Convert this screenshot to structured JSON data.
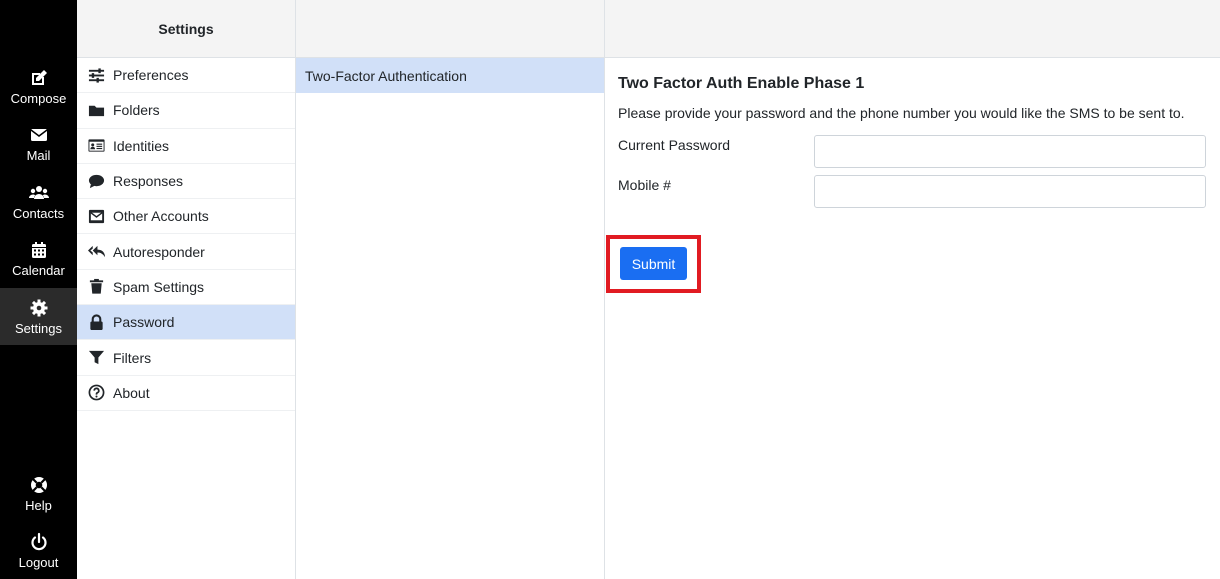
{
  "taskbar": {
    "items": [
      {
        "label": "Compose",
        "icon": "compose-icon"
      },
      {
        "label": "Mail",
        "icon": "mail-icon"
      },
      {
        "label": "Contacts",
        "icon": "contacts-icon"
      },
      {
        "label": "Calendar",
        "icon": "calendar-icon"
      },
      {
        "label": "Settings",
        "icon": "gear-icon",
        "active": true
      },
      {
        "label": "Help",
        "icon": "lifebuoy-icon"
      },
      {
        "label": "Logout",
        "icon": "power-icon"
      }
    ]
  },
  "settings": {
    "title": "Settings",
    "items": [
      {
        "label": "Preferences",
        "icon": "sliders-icon"
      },
      {
        "label": "Folders",
        "icon": "folder-icon"
      },
      {
        "label": "Identities",
        "icon": "id-card-icon"
      },
      {
        "label": "Responses",
        "icon": "comment-icon"
      },
      {
        "label": "Other Accounts",
        "icon": "envelope-square-icon"
      },
      {
        "label": "Autoresponder",
        "icon": "reply-all-icon"
      },
      {
        "label": "Spam Settings",
        "icon": "trash-icon"
      },
      {
        "label": "Password",
        "icon": "lock-icon",
        "selected": true
      },
      {
        "label": "Filters",
        "icon": "filter-icon"
      },
      {
        "label": "About",
        "icon": "question-circle-icon"
      }
    ]
  },
  "list": {
    "items": [
      {
        "label": "Two-Factor Authentication",
        "selected": true
      }
    ]
  },
  "form": {
    "title": "Two Factor Auth Enable Phase 1",
    "description": "Please provide your password and the phone number you would like the SMS to be sent to.",
    "password_label": "Current Password",
    "password_value": "",
    "mobile_label": "Mobile #",
    "mobile_value": "",
    "submit_label": "Submit"
  },
  "colors": {
    "taskbar_bg": "#000000",
    "selected_bg": "#d1e0f8",
    "button_bg": "#1a6ef2",
    "highlight_border": "#e11b22"
  }
}
